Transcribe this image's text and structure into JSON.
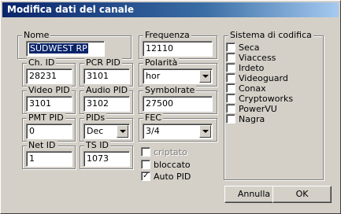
{
  "window": {
    "title": "Modifica dati del canale"
  },
  "fields": {
    "nome": {
      "label": "Nome",
      "value": "SÜDWEST RP"
    },
    "frequenza": {
      "label": "Frequenza",
      "value": "12110"
    },
    "ch_id": {
      "label": "Ch. ID",
      "value": "28231"
    },
    "pcr_pid": {
      "label": "PCR PID",
      "value": "3101"
    },
    "polarita": {
      "label": "Polarità",
      "value": "hor"
    },
    "video_pid": {
      "label": "Video PID",
      "value": "3101"
    },
    "audio_pid": {
      "label": "Audio PID",
      "value": "3102"
    },
    "symbolrate": {
      "label": "Symbolrate",
      "value": "27500"
    },
    "pmt_pid": {
      "label": "PMT PID",
      "value": "0"
    },
    "pids": {
      "label": "PIDs",
      "value": "Dec"
    },
    "fec": {
      "label": "FEC",
      "value": "3/4"
    },
    "net_id": {
      "label": "Net ID",
      "value": "1"
    },
    "ts_id": {
      "label": "TS ID",
      "value": "1073"
    }
  },
  "flags": {
    "criptato": {
      "label": "criptato",
      "checked": false,
      "enabled": false
    },
    "bloccato": {
      "label": "bloccato",
      "checked": false,
      "enabled": true
    },
    "auto_pid": {
      "label": "Auto PID",
      "checked": true,
      "enabled": true
    }
  },
  "encryption": {
    "title": "Sistema di codifica",
    "systems": [
      {
        "label": "Seca",
        "checked": false
      },
      {
        "label": "Viaccess",
        "checked": false
      },
      {
        "label": "Irdeto",
        "checked": false
      },
      {
        "label": "Videoguard",
        "checked": false
      },
      {
        "label": "Conax",
        "checked": false
      },
      {
        "label": "Cryptoworks",
        "checked": false
      },
      {
        "label": "PowerVU",
        "checked": false
      },
      {
        "label": "Nagra",
        "checked": false
      }
    ]
  },
  "buttons": {
    "cancel": "Annulla",
    "ok": "OK"
  }
}
